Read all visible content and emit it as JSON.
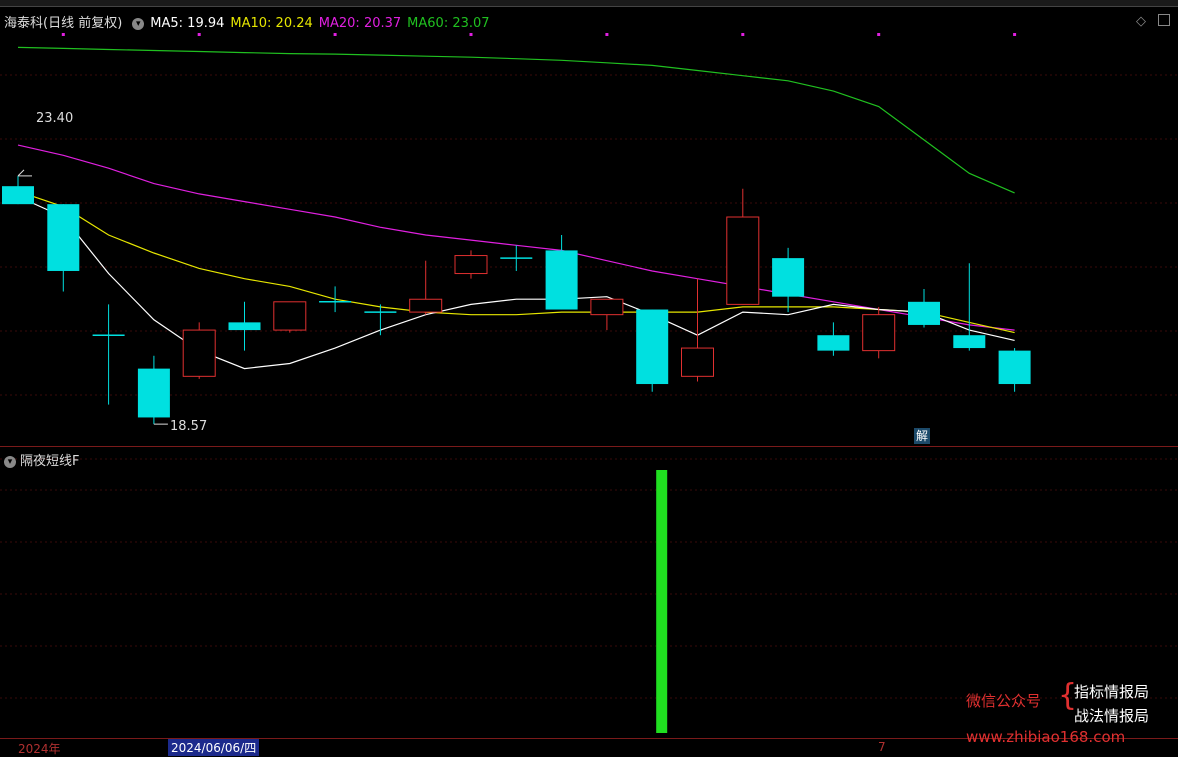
{
  "header": {
    "stock": "海泰科(日线 前复权)",
    "ma5_label": "MA5: 19.94",
    "ma10_label": "MA10: 20.24",
    "ma20_label": "MA20: 20.37",
    "ma60_label": "MA60: 23.07",
    "colors": {
      "ma5": "#ffffff",
      "ma10": "#e6e600",
      "ma20": "#e020e0",
      "ma60": "#20c020"
    }
  },
  "controls": {
    "diamond": "◇"
  },
  "annotations": {
    "high": "23.40",
    "low": "18.57",
    "jie": "解"
  },
  "indicator": {
    "name": "隔夜短线F"
  },
  "date_axis": {
    "year": "2024年",
    "selected_date": "2024/06/06/四",
    "month": "7"
  },
  "watermark": {
    "wechat": "微信公众号",
    "line1": "指标情报局",
    "line2": "战法情报局",
    "url": "www.zhibiao168.com"
  },
  "chart_data": {
    "type": "candlestick",
    "candles": [
      {
        "o": 23.2,
        "h": 23.4,
        "l": 22.85,
        "c": 22.85
      },
      {
        "o": 22.85,
        "h": 22.85,
        "l": 21.15,
        "c": 21.55
      },
      {
        "o": 20.3,
        "h": 20.9,
        "l": 18.95,
        "c": 20.3
      },
      {
        "o": 19.65,
        "h": 19.9,
        "l": 18.57,
        "c": 18.7
      },
      {
        "o": 19.5,
        "h": 20.55,
        "l": 19.45,
        "c": 20.4
      },
      {
        "o": 20.55,
        "h": 20.95,
        "l": 20.0,
        "c": 20.4
      },
      {
        "o": 20.4,
        "h": 20.95,
        "l": 20.35,
        "c": 20.95
      },
      {
        "o": 20.95,
        "h": 21.25,
        "l": 20.75,
        "c": 20.95
      },
      {
        "o": 20.75,
        "h": 20.9,
        "l": 20.3,
        "c": 20.75
      },
      {
        "o": 20.75,
        "h": 21.75,
        "l": 20.7,
        "c": 21.0
      },
      {
        "o": 21.5,
        "h": 21.95,
        "l": 21.4,
        "c": 21.85
      },
      {
        "o": 21.8,
        "h": 22.05,
        "l": 21.55,
        "c": 21.8
      },
      {
        "o": 21.95,
        "h": 22.25,
        "l": 20.8,
        "c": 20.8
      },
      {
        "o": 20.7,
        "h": 20.85,
        "l": 20.4,
        "c": 21.0
      },
      {
        "o": 20.8,
        "h": 20.8,
        "l": 19.2,
        "c": 19.35
      },
      {
        "o": 19.5,
        "h": 21.4,
        "l": 19.4,
        "c": 20.05
      },
      {
        "o": 20.9,
        "h": 23.15,
        "l": 20.9,
        "c": 22.6
      },
      {
        "o": 21.8,
        "h": 22.0,
        "l": 20.75,
        "c": 21.05
      },
      {
        "o": 20.3,
        "h": 20.55,
        "l": 19.9,
        "c": 20.0
      },
      {
        "o": 20.0,
        "h": 20.85,
        "l": 19.85,
        "c": 20.7
      },
      {
        "o": 20.95,
        "h": 21.2,
        "l": 20.45,
        "c": 20.5
      },
      {
        "o": 20.3,
        "h": 21.7,
        "l": 20.0,
        "c": 20.05
      },
      {
        "o": 20.0,
        "h": 20.05,
        "l": 19.2,
        "c": 19.35
      }
    ],
    "ma5": [
      23.0,
      22.6,
      21.5,
      20.6,
      20.0,
      19.65,
      19.75,
      20.05,
      20.4,
      20.7,
      20.9,
      21.0,
      21.0,
      21.05,
      20.7,
      20.3,
      20.75,
      20.7,
      20.9,
      20.8,
      20.75,
      20.4,
      20.2
    ],
    "ma10": [
      23.1,
      22.8,
      22.25,
      21.9,
      21.6,
      21.4,
      21.25,
      21.0,
      20.85,
      20.75,
      20.7,
      20.7,
      20.75,
      20.75,
      20.75,
      20.75,
      20.85,
      20.85,
      20.85,
      20.8,
      20.75,
      20.55,
      20.35
    ],
    "ma20": [
      24.0,
      23.8,
      23.55,
      23.25,
      23.05,
      22.9,
      22.75,
      22.6,
      22.4,
      22.25,
      22.15,
      22.05,
      21.95,
      21.75,
      21.55,
      21.4,
      21.25,
      21.1,
      20.95,
      20.8,
      20.65,
      20.5,
      20.4
    ],
    "ma60": [
      25.9,
      25.88,
      25.86,
      25.84,
      25.82,
      25.8,
      25.78,
      25.77,
      25.75,
      25.73,
      25.71,
      25.68,
      25.65,
      25.6,
      25.55,
      25.45,
      25.35,
      25.25,
      25.05,
      24.75,
      24.1,
      23.45,
      23.07
    ],
    "ylim": [
      18.3,
      26.2
    ],
    "indicator_values": [
      0,
      0,
      0,
      0,
      0,
      0,
      0,
      0,
      0,
      0,
      0,
      0,
      0,
      0,
      1,
      0,
      0,
      0,
      0,
      0,
      0,
      0,
      0
    ],
    "colors": {
      "up": "#e03030",
      "down": "#00e0e0",
      "flat": "#00e0e0",
      "indicator": "#20e020"
    }
  }
}
